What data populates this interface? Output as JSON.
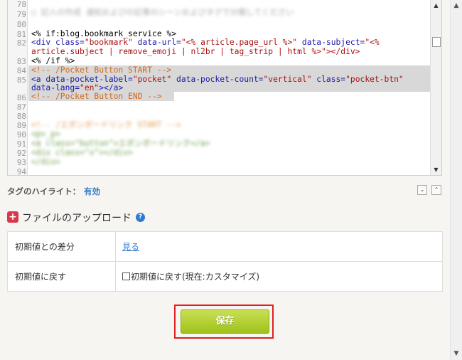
{
  "editor": {
    "line_numbers": [
      "78",
      "79",
      "80",
      "81",
      "82",
      "",
      "83",
      "84",
      "85",
      "",
      "86",
      "87",
      "88",
      "89",
      "90",
      "91",
      "92",
      "93",
      "94"
    ],
    "blurred_top": "□ 記入の作成 通知およびの記事のシーンおよびタグで分類してください",
    "line81": "<% if:blog.bookmark_service %>",
    "line82a_tag": "<div class=",
    "line82a_str1": "\"bookmark\"",
    "line82a_mid": " data-url=",
    "line82a_str2": "\"<% article.page_url %>\"",
    "line82a_mid2": " data-subject=",
    "line82a_str3": "\"<%",
    "line82b": "article.subject | remove_emoji | nl2br | tag_strip | html %>\"></div>",
    "line83": "<% /if %>",
    "line84": "<!-- /Pocket Button START -->",
    "line85a_tag": "<a data-pocket-label=",
    "line85a_str1": "\"pocket\"",
    "line85a_mid": " data-pocket-count=",
    "line85a_str2": "\"vertical\"",
    "line85a_mid2": " class=",
    "line85a_str3": "\"pocket-btn\"",
    "line85b_tag": "data-lang=",
    "line85b_str": "\"en\"",
    "line85b_end": "></a>",
    "line86": "<!-- /Pocket Button END -->",
    "blurred_89": "<!-- /エボンボードリンク START -->",
    "blurred_90": "<p>_p>",
    "blurred_91": "<a class=\"button\">エボンボードリンク</a>",
    "blurred_92": "<div class=\"x\"></div>",
    "blurred_93": "</div>"
  },
  "highlight": {
    "label": "タグのハイライト：",
    "value": "有効"
  },
  "upload": {
    "title": "ファイルのアップロード",
    "help": "?"
  },
  "settings": {
    "rows": [
      {
        "label": "初期値との差分",
        "value": "見る"
      },
      {
        "label": "初期値に戻す",
        "value": "初期値に戻す(現在:カスタマイズ)"
      }
    ]
  },
  "save_button": {
    "label": "保存"
  },
  "colors": {
    "accent": "#9fc21a",
    "highlight_border": "#e02020",
    "link": "#2e7cd1"
  }
}
